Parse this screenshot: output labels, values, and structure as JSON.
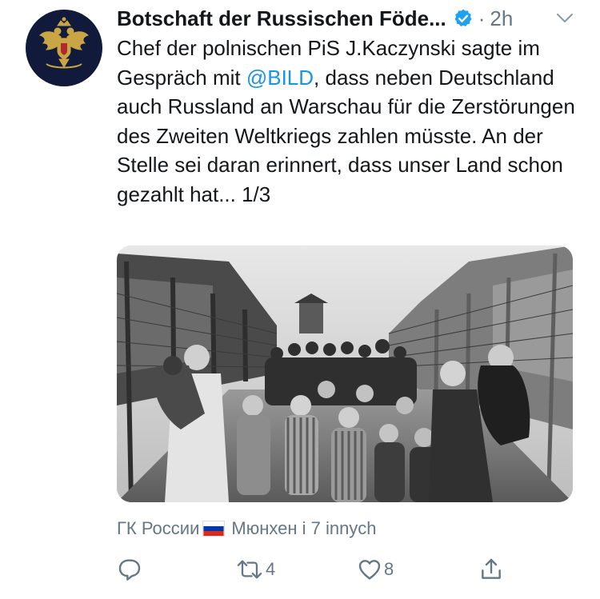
{
  "tweet": {
    "display_name": "Botschaft der Russischen Föde...",
    "separator": "·",
    "time": "2h",
    "text_before_mention": "Chef der polnischen PiS J.Kaczynski sagte im Gespräch mit ",
    "mention": "@BILD",
    "text_after_mention": ", dass neben Deutschland auch Russland an Warschau für die Zerstörungen des Zweiten Weltkriegs zahlen müsste. An der Stelle sei daran erinnert, dass unser Land schon gezahlt hat... 1/3",
    "tagged_first": "ГК России",
    "tagged_rest": "Мюнхен і 7 innych",
    "retweet_count": "4",
    "like_count": "8"
  },
  "icons": {
    "avatar": "russian-coat-of-arms",
    "verified": "verified-badge-icon",
    "caret": "chevron-down-icon",
    "reply": "reply-icon",
    "retweet": "retweet-icon",
    "like": "heart-icon",
    "share": "share-icon",
    "flag": "russia-flag-icon"
  },
  "colors": {
    "link": "#1b95e0",
    "secondary_text": "#657786",
    "avatar_background": "#111a3a",
    "emblem_gold": "#c9a545"
  }
}
